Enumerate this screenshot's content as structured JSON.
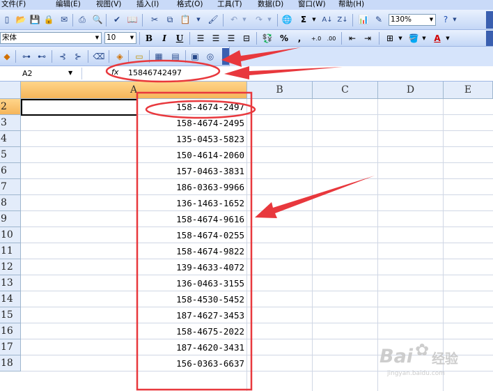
{
  "menubar": {
    "items": [
      "文件(F)",
      "编辑(E)",
      "视图(V)",
      "插入(I)",
      "格式(O)",
      "工具(T)",
      "数据(D)",
      "窗口(W)",
      "帮助(H)"
    ]
  },
  "toolbar": {
    "zoom": "130%",
    "font_name": "宋体",
    "font_size": "10",
    "bold": "B",
    "italic": "I",
    "underline": "U",
    "percent": "%",
    "comma": ",",
    "sigma": "Σ"
  },
  "formula_bar": {
    "name_box": "A2",
    "fx_label": "fx",
    "value": "15846742497"
  },
  "sheet": {
    "columns": [
      "A",
      "B",
      "C",
      "D",
      "E"
    ],
    "rows": [
      "2",
      "3",
      "4",
      "5",
      "6",
      "7",
      "8",
      "9",
      "10",
      "11",
      "12",
      "13",
      "14",
      "15",
      "16",
      "17",
      "18"
    ],
    "values": [
      "158-4674-2497",
      "158-4674-2495",
      "135-0453-5823",
      "150-4614-2060",
      "157-0463-3831",
      "186-0363-9966",
      "136-1463-1652",
      "158-4674-9616",
      "158-4674-0255",
      "158-4674-9822",
      "139-4633-4072",
      "136-0463-3155",
      "158-4530-5452",
      "187-4627-3453",
      "158-4675-2022",
      "187-4620-3431",
      "156-0363-6637"
    ]
  },
  "watermark": {
    "brand": "Bai",
    "brand2": "经验",
    "url": "jingyan.baidu.com"
  },
  "colors": {
    "annotation": "#e8383d",
    "selected_header": "#f5b55a"
  }
}
